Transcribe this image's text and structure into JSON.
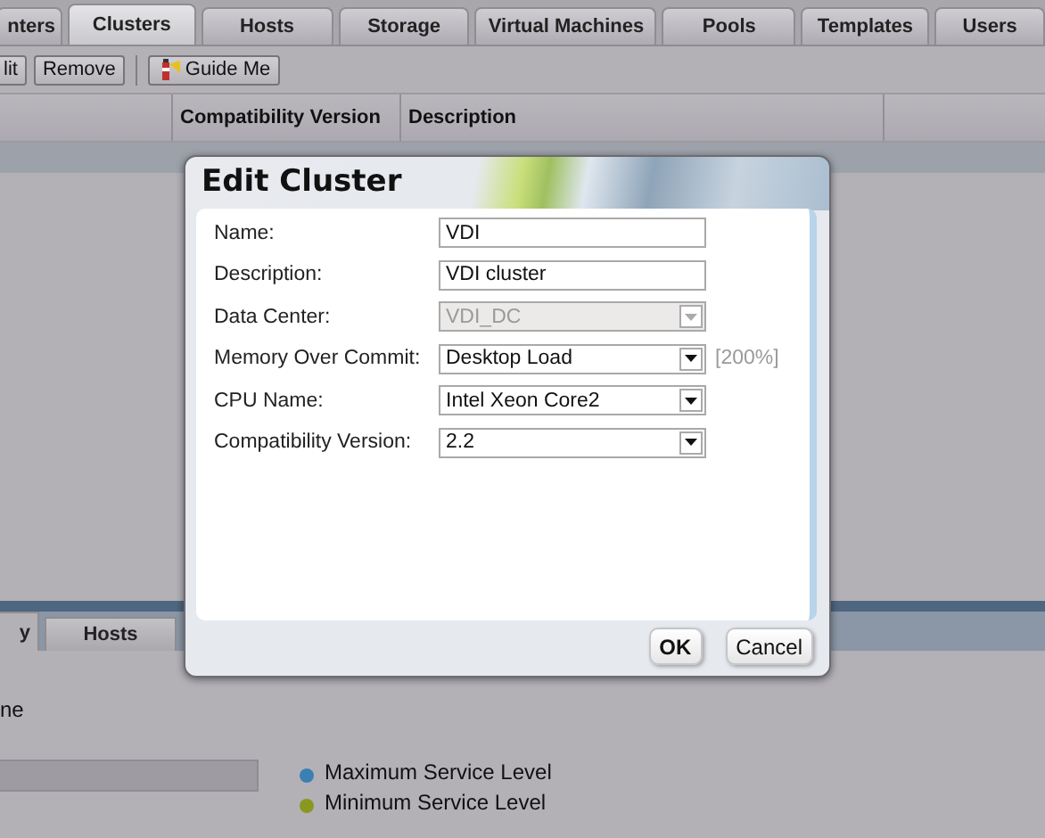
{
  "top_tabs": [
    {
      "label": "nters",
      "selected": false
    },
    {
      "label": "Clusters",
      "selected": true
    },
    {
      "label": "Hosts",
      "selected": false
    },
    {
      "label": "Storage",
      "selected": false
    },
    {
      "label": "Virtual Machines",
      "selected": false
    },
    {
      "label": "Pools",
      "selected": false
    },
    {
      "label": "Templates",
      "selected": false
    },
    {
      "label": "Users",
      "selected": false
    }
  ],
  "toolbar": [
    {
      "label": "lit",
      "kind": "button"
    },
    {
      "label": "Remove",
      "kind": "button"
    },
    {
      "label": "Guide Me",
      "kind": "guide"
    }
  ],
  "table": {
    "columns": [
      "Compatibility Version",
      "Description"
    ]
  },
  "bottom_tabs": [
    {
      "label": "y",
      "selected": true
    },
    {
      "label": "Hosts",
      "selected": false
    }
  ],
  "bottom_panel": {
    "text": "ne",
    "legend": [
      {
        "label": "Maximum Service Level",
        "color": "#3b80b2"
      },
      {
        "label": "Minimum Service Level",
        "color": "#8a9820"
      }
    ]
  },
  "dialog": {
    "title": "Edit Cluster",
    "fields": [
      {
        "label": "Name:",
        "kind": "text",
        "value": "VDI",
        "disabled": false
      },
      {
        "label": "Description:",
        "kind": "text",
        "value": "VDI cluster",
        "disabled": false
      },
      {
        "label": "Data Center:",
        "kind": "select",
        "value": "VDI_DC",
        "disabled": true
      },
      {
        "label": "Memory Over Commit:",
        "kind": "select",
        "value": "Desktop Load",
        "disabled": false,
        "note": "[200%]"
      },
      {
        "label": "CPU Name:",
        "kind": "select",
        "value": "Intel Xeon Core2",
        "disabled": false
      },
      {
        "label": "Compatibility Version:",
        "kind": "select",
        "value": "2.2",
        "disabled": false
      }
    ],
    "buttons": [
      {
        "label": "OK",
        "default": true
      },
      {
        "label": "Cancel",
        "default": false
      }
    ]
  }
}
